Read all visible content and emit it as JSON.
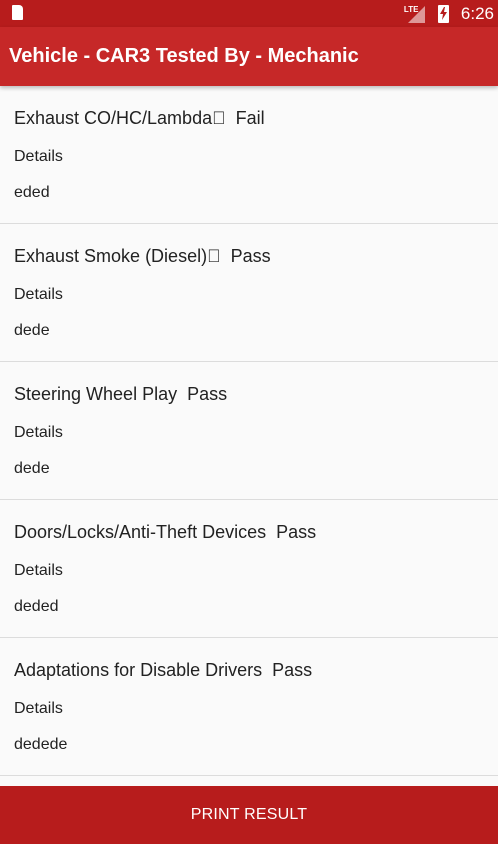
{
  "status_bar": {
    "network_label": "LTE",
    "clock": "6:26",
    "icons": [
      "sd-card-icon",
      "signal-icon",
      "battery-charging-icon"
    ]
  },
  "app_bar": {
    "title": "Vehicle - CAR3 Tested By - Mechanic"
  },
  "items": [
    {
      "name": "Exhaust CO/HC/Lambda\u0000",
      "result": "Fail",
      "details_label": "Details",
      "details": "eded"
    },
    {
      "name": "Exhaust Smoke (Diesel)\u0000",
      "result": "Pass",
      "details_label": "Details",
      "details": "dede"
    },
    {
      "name": "Steering Wheel Play",
      "result": "Pass",
      "details_label": "Details",
      "details": "dede"
    },
    {
      "name": "Doors/Locks/Anti-Theft Devices",
      "result": "Pass",
      "details_label": "Details",
      "details": "deded"
    },
    {
      "name": "Adaptations for Disable Drivers",
      "result": "Pass",
      "details_label": "Details",
      "details": "dedede"
    }
  ],
  "print_button_label": "PRINT RESULT",
  "colors": {
    "status_bar": "#b71c1c",
    "app_bar": "#c62828",
    "button": "#b71c1c",
    "background": "#fafafa",
    "divider": "#dcdcdc"
  }
}
